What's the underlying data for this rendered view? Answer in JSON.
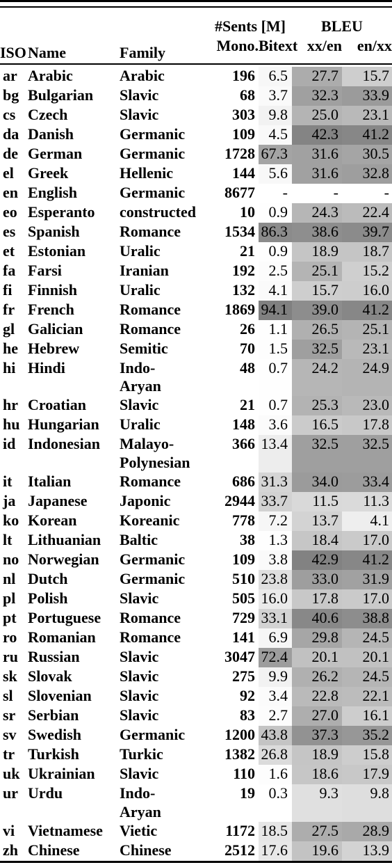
{
  "header": {
    "iso": "ISO",
    "name": "Name",
    "family": "Family",
    "sents_group": "#Sents [M]",
    "bleu_group": "BLEU",
    "mono": "Mono.",
    "bitext": "Bitext",
    "xx_en": "xx/en",
    "en_xx": "en/xx"
  },
  "chart_data": {
    "type": "table",
    "title": "",
    "columns": [
      "ISO",
      "Name",
      "Family",
      "Mono.",
      "Bitext",
      "xx/en",
      "en/xx"
    ],
    "column_groups": [
      {
        "label": "#Sents [M]",
        "columns": [
          "Mono.",
          "Bitext"
        ]
      },
      {
        "label": "BLEU",
        "columns": [
          "xx/en",
          "en/xx"
        ]
      }
    ],
    "heatmap_columns": [
      "Bitext",
      "xx/en",
      "en/xx"
    ],
    "rows": [
      {
        "iso": "ar",
        "name": "Arabic",
        "family": "Arabic",
        "mono": "196",
        "bitext": "6.5",
        "xx_en": "27.7",
        "en_xx": "15.7"
      },
      {
        "iso": "bg",
        "name": "Bulgarian",
        "family": "Slavic",
        "mono": "68",
        "bitext": "3.7",
        "xx_en": "32.3",
        "en_xx": "33.9"
      },
      {
        "iso": "cs",
        "name": "Czech",
        "family": "Slavic",
        "mono": "303",
        "bitext": "9.8",
        "xx_en": "25.0",
        "en_xx": "23.1"
      },
      {
        "iso": "da",
        "name": "Danish",
        "family": "Germanic",
        "mono": "109",
        "bitext": "4.5",
        "xx_en": "42.3",
        "en_xx": "41.2"
      },
      {
        "iso": "de",
        "name": "German",
        "family": "Germanic",
        "mono": "1728",
        "bitext": "67.3",
        "xx_en": "31.6",
        "en_xx": "30.5"
      },
      {
        "iso": "el",
        "name": "Greek",
        "family": "Hellenic",
        "mono": "144",
        "bitext": "5.6",
        "xx_en": "31.6",
        "en_xx": "32.8"
      },
      {
        "iso": "en",
        "name": "English",
        "family": "Germanic",
        "mono": "8677",
        "bitext": "-",
        "xx_en": "-",
        "en_xx": "-"
      },
      {
        "iso": "eo",
        "name": "Esperanto",
        "family": "constructed",
        "mono": "10",
        "bitext": "0.9",
        "xx_en": "24.3",
        "en_xx": "22.4"
      },
      {
        "iso": "es",
        "name": "Spanish",
        "family": "Romance",
        "mono": "1534",
        "bitext": "86.3",
        "xx_en": "38.6",
        "en_xx": "39.7"
      },
      {
        "iso": "et",
        "name": "Estonian",
        "family": "Uralic",
        "mono": "21",
        "bitext": "0.9",
        "xx_en": "18.9",
        "en_xx": "18.7"
      },
      {
        "iso": "fa",
        "name": "Farsi",
        "family": "Iranian",
        "mono": "192",
        "bitext": "2.5",
        "xx_en": "25.1",
        "en_xx": "15.2"
      },
      {
        "iso": "fi",
        "name": "Finnish",
        "family": "Uralic",
        "mono": "132",
        "bitext": "4.1",
        "xx_en": "15.7",
        "en_xx": "16.0"
      },
      {
        "iso": "fr",
        "name": "French",
        "family": "Romance",
        "mono": "1869",
        "bitext": "94.1",
        "xx_en": "39.0",
        "en_xx": "41.2"
      },
      {
        "iso": "gl",
        "name": "Galician",
        "family": "Romance",
        "mono": "26",
        "bitext": "1.1",
        "xx_en": "26.5",
        "en_xx": "25.1"
      },
      {
        "iso": "he",
        "name": "Hebrew",
        "family": "Semitic",
        "mono": "70",
        "bitext": "1.5",
        "xx_en": "32.5",
        "en_xx": "23.1"
      },
      {
        "iso": "hi",
        "name": "Hindi",
        "family": "Indo-\nAryan",
        "mono": "48",
        "bitext": "0.7",
        "xx_en": "24.2",
        "en_xx": "24.9"
      },
      {
        "iso": "hr",
        "name": "Croatian",
        "family": "Slavic",
        "mono": "21",
        "bitext": "0.7",
        "xx_en": "25.3",
        "en_xx": "23.0"
      },
      {
        "iso": "hu",
        "name": "Hungarian",
        "family": "Uralic",
        "mono": "148",
        "bitext": "3.6",
        "xx_en": "16.5",
        "en_xx": "17.8"
      },
      {
        "iso": "id",
        "name": "Indonesian",
        "family": "Malayo-\nPolynesian",
        "mono": "366",
        "bitext": "13.4",
        "xx_en": "32.5",
        "en_xx": "32.5"
      },
      {
        "iso": "it",
        "name": "Italian",
        "family": "Romance",
        "mono": "686",
        "bitext": "31.3",
        "xx_en": "34.0",
        "en_xx": "33.4"
      },
      {
        "iso": "ja",
        "name": "Japanese",
        "family": "Japonic",
        "mono": "2944",
        "bitext": "33.7",
        "xx_en": "11.5",
        "en_xx": "11.3"
      },
      {
        "iso": "ko",
        "name": "Korean",
        "family": "Koreanic",
        "mono": "778",
        "bitext": "7.2",
        "xx_en": "13.7",
        "en_xx": "4.1"
      },
      {
        "iso": "lt",
        "name": "Lithuanian",
        "family": "Baltic",
        "mono": "38",
        "bitext": "1.3",
        "xx_en": "18.4",
        "en_xx": "17.0"
      },
      {
        "iso": "no",
        "name": "Norwegian",
        "family": "Germanic",
        "mono": "109",
        "bitext": "3.8",
        "xx_en": "42.9",
        "en_xx": "41.2"
      },
      {
        "iso": "nl",
        "name": "Dutch",
        "family": "Germanic",
        "mono": "510",
        "bitext": "23.8",
        "xx_en": "33.0",
        "en_xx": "31.9"
      },
      {
        "iso": "pl",
        "name": "Polish",
        "family": "Slavic",
        "mono": "505",
        "bitext": "16.0",
        "xx_en": "17.8",
        "en_xx": "17.0"
      },
      {
        "iso": "pt",
        "name": "Portuguese",
        "family": "Romance",
        "mono": "729",
        "bitext": "33.1",
        "xx_en": "40.6",
        "en_xx": "38.8"
      },
      {
        "iso": "ro",
        "name": "Romanian",
        "family": "Romance",
        "mono": "141",
        "bitext": "6.9",
        "xx_en": "29.8",
        "en_xx": "24.5"
      },
      {
        "iso": "ru",
        "name": "Russian",
        "family": "Slavic",
        "mono": "3047",
        "bitext": "72.4",
        "xx_en": "20.1",
        "en_xx": "20.1"
      },
      {
        "iso": "sk",
        "name": "Slovak",
        "family": "Slavic",
        "mono": "275",
        "bitext": "9.9",
        "xx_en": "26.2",
        "en_xx": "24.5"
      },
      {
        "iso": "sl",
        "name": "Slovenian",
        "family": "Slavic",
        "mono": "92",
        "bitext": "3.4",
        "xx_en": "22.8",
        "en_xx": "22.1"
      },
      {
        "iso": "sr",
        "name": "Serbian",
        "family": "Slavic",
        "mono": "83",
        "bitext": "2.7",
        "xx_en": "27.0",
        "en_xx": "16.1"
      },
      {
        "iso": "sv",
        "name": "Swedish",
        "family": "Germanic",
        "mono": "1200",
        "bitext": "43.8",
        "xx_en": "37.3",
        "en_xx": "35.2"
      },
      {
        "iso": "tr",
        "name": "Turkish",
        "family": "Turkic",
        "mono": "1382",
        "bitext": "26.8",
        "xx_en": "18.9",
        "en_xx": "15.8"
      },
      {
        "iso": "uk",
        "name": "Ukrainian",
        "family": "Slavic",
        "mono": "110",
        "bitext": "1.6",
        "xx_en": "18.6",
        "en_xx": "17.9"
      },
      {
        "iso": "ur",
        "name": "Urdu",
        "family": "Indo-\nAryan",
        "mono": "19",
        "bitext": "0.3",
        "xx_en": "9.3",
        "en_xx": "9.8"
      },
      {
        "iso": "vi",
        "name": "Vietnamese",
        "family": "Vietic",
        "mono": "1172",
        "bitext": "18.5",
        "xx_en": "27.5",
        "en_xx": "28.9"
      },
      {
        "iso": "zh",
        "name": "Chinese",
        "family": "Chinese",
        "mono": "2512",
        "bitext": "17.6",
        "xx_en": "19.6",
        "en_xx": "13.9"
      }
    ],
    "heatmap": {
      "bitext": {
        "min": 0.3,
        "max": 94.1,
        "light": "#ffffff",
        "dark": "#8c8c8c"
      },
      "bleu": {
        "min": 4.1,
        "max": 42.9,
        "light": "#f0f0f0",
        "dark": "#878787"
      }
    }
  }
}
